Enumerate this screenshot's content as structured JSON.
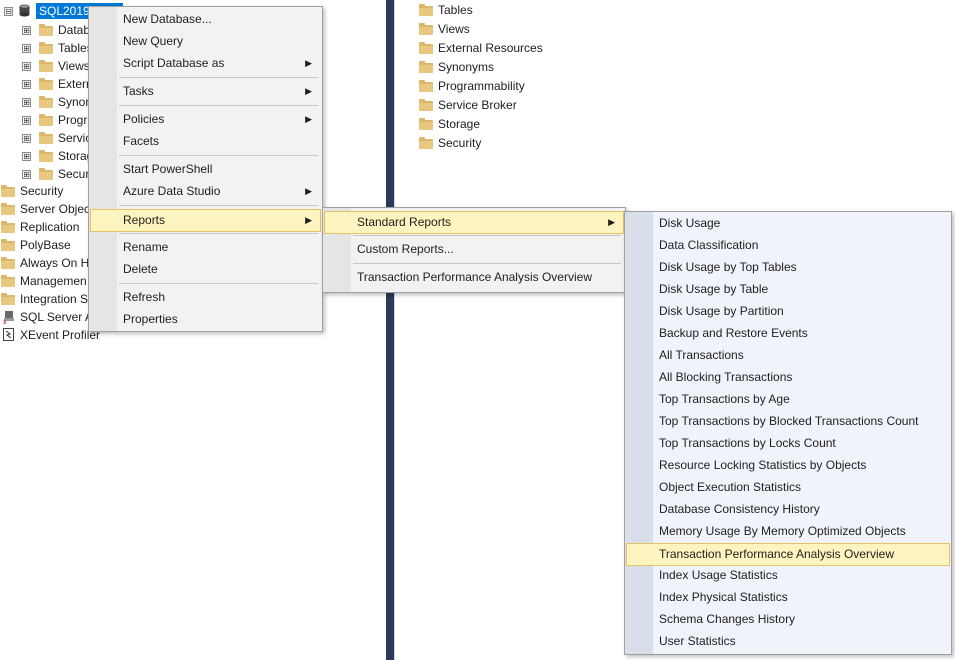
{
  "object_explorer": {
    "server_label": "SQL2019",
    "db_children": [
      "Datab",
      "Tables",
      "Views",
      "Extern",
      "Synon",
      "Progr",
      "Servic",
      "Storag",
      "Secur"
    ],
    "server_nodes": [
      "Security",
      "Server Objec",
      "Replication",
      "PolyBase",
      "Always On H",
      "Managemen",
      "Integration S",
      "SQL Server A",
      "XEvent Profiler"
    ]
  },
  "details_list": [
    "Tables",
    "Views",
    "External Resources",
    "Synonyms",
    "Programmability",
    "Service Broker",
    "Storage",
    "Security"
  ],
  "context_menu": {
    "items": [
      {
        "label": "New Database...",
        "submenu": false
      },
      {
        "label": "New Query",
        "submenu": false
      },
      {
        "label": "Script Database as",
        "submenu": true
      },
      {
        "label": "Tasks",
        "submenu": true
      },
      {
        "label": "Policies",
        "submenu": true
      },
      {
        "label": "Facets",
        "submenu": false
      },
      {
        "label": "Start PowerShell",
        "submenu": false
      },
      {
        "label": "Azure Data Studio",
        "submenu": true
      },
      {
        "label": "Reports",
        "submenu": true
      },
      {
        "label": "Rename",
        "submenu": false
      },
      {
        "label": "Delete",
        "submenu": false
      },
      {
        "label": "Refresh",
        "submenu": false
      },
      {
        "label": "Properties",
        "submenu": false
      }
    ]
  },
  "reports_menu": {
    "items": [
      {
        "label": "Standard Reports",
        "submenu": true
      },
      {
        "label": "Custom Reports...",
        "submenu": false
      },
      {
        "label": "Transaction Performance Analysis Overview",
        "submenu": false
      }
    ]
  },
  "standard_reports_menu": {
    "items": [
      "Disk Usage",
      "Data Classification",
      "Disk Usage by Top Tables",
      "Disk Usage by Table",
      "Disk Usage by Partition",
      "Backup and Restore Events",
      "All Transactions",
      "All Blocking Transactions",
      "Top Transactions by Age",
      "Top Transactions by Blocked Transactions Count",
      "Top Transactions by Locks Count",
      "Resource Locking Statistics by Objects",
      "Object Execution Statistics",
      "Database Consistency History",
      "Memory Usage By Memory Optimized Objects",
      "Transaction Performance Analysis Overview",
      "Index Usage Statistics",
      "Index Physical Statistics",
      "Schema Changes History",
      "User Statistics"
    ],
    "highlighted_index": 15
  },
  "icons": {
    "expand": "⊞",
    "collapse": "⊟",
    "submenu_arrow": "▶"
  },
  "colors": {
    "highlight_bg": "#fdf4bf",
    "selection_bg": "#0078d7",
    "divider": "#2b3a5a"
  }
}
